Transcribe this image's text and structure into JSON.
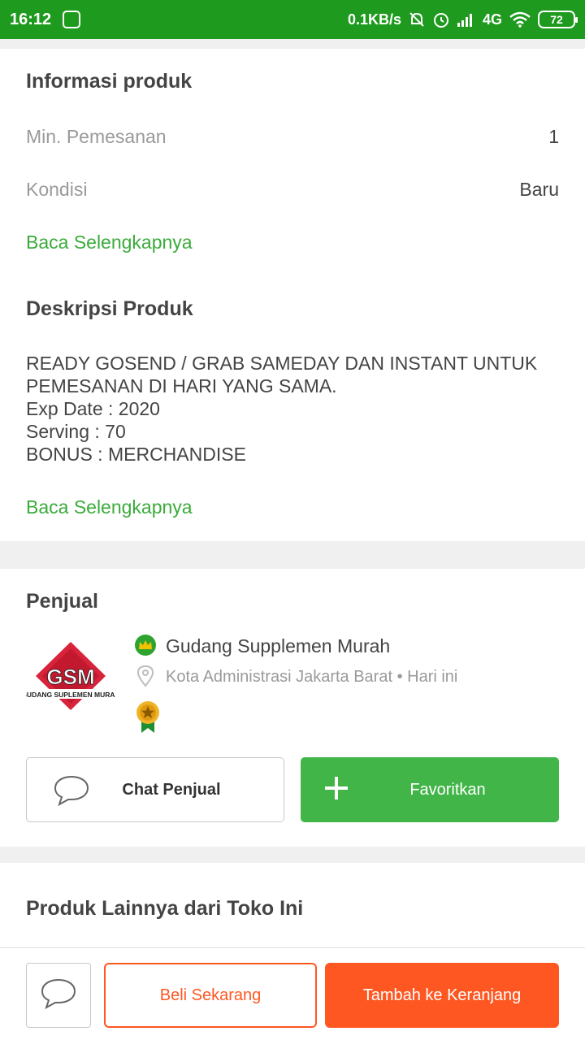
{
  "status_bar": {
    "time": "16:12",
    "network_speed": "0.1KB/s",
    "network_type": "4G",
    "battery": "72"
  },
  "product_info": {
    "title": "Informasi produk",
    "rows": [
      {
        "label": "Min. Pemesanan",
        "value": "1"
      },
      {
        "label": "Kondisi",
        "value": "Baru"
      }
    ],
    "read_more": "Baca Selengkapnya"
  },
  "description": {
    "title": "Deskripsi Produk",
    "lines": [
      "READY GOSEND / GRAB SAMEDAY DAN INSTANT UNTUK",
      "PEMESANAN DI HARI YANG SAMA.",
      "Exp Date : 2020",
      "Serving : 70",
      "BONUS : MERCHANDISE"
    ],
    "read_more": "Baca Selengkapnya"
  },
  "seller": {
    "title": "Penjual",
    "logo_text": "GSM",
    "logo_subtext": "GUDANG SUPLEMEN MURAH",
    "name": "Gudang Supplemen Murah",
    "location": "Kota Administrasi Jakarta Barat",
    "last_active": "• Hari ini",
    "chat_label": "Chat Penjual",
    "favorite_label": "Favoritkan"
  },
  "other_products": {
    "title": "Produk Lainnya dari Toko Ini"
  },
  "bottom_bar": {
    "buy_now": "Beli Sekarang",
    "add_to_cart": "Tambah ke Keranjang"
  },
  "colors": {
    "status_bar": "#1e9a1e",
    "link_green": "#3bab3b",
    "favorite_green": "#42b549",
    "orange": "#ff5722"
  },
  "icons": [
    "shop-app-icon",
    "alarm-off-icon",
    "alarm-icon",
    "signal-icon",
    "wifi-icon",
    "battery-icon",
    "crown-badge-icon",
    "location-pin-icon",
    "gold-medal-icon",
    "chat-bubble-icon",
    "plus-icon"
  ]
}
